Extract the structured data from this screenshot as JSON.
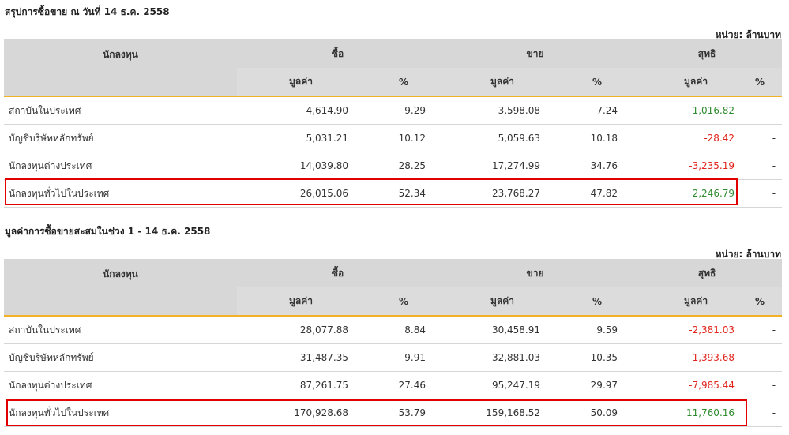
{
  "section1": {
    "title": "สรุปการซื้อขาย ณ วันที่ 14 ธ.ค. 2558",
    "unit": "หน่วย: ล้านบาท",
    "headers": {
      "investor": "นักลงทุน",
      "buy": "ซื้อ",
      "sell": "ขาย",
      "net": "สุทธิ",
      "value": "มูลค่า",
      "percent": "%"
    },
    "rows": [
      {
        "name": "สถาบันในประเทศ",
        "buy_value": "4,614.90",
        "buy_pct": "9.29",
        "sell_value": "3,598.08",
        "sell_pct": "7.24",
        "net_value": "1,016.82",
        "net_pct": "-",
        "net_sign": "pos"
      },
      {
        "name": "บัญชีบริษัทหลักทรัพย์",
        "buy_value": "5,031.21",
        "buy_pct": "10.12",
        "sell_value": "5,059.63",
        "sell_pct": "10.18",
        "net_value": "-28.42",
        "net_pct": "-",
        "net_sign": "neg"
      },
      {
        "name": "นักลงทุนต่างประเทศ",
        "buy_value": "14,039.80",
        "buy_pct": "28.25",
        "sell_value": "17,274.99",
        "sell_pct": "34.76",
        "net_value": "-3,235.19",
        "net_pct": "-",
        "net_sign": "neg"
      },
      {
        "name": "นักลงทุนทั่วไปในประเทศ",
        "buy_value": "26,015.06",
        "buy_pct": "52.34",
        "sell_value": "23,768.27",
        "sell_pct": "47.82",
        "net_value": "2,246.79",
        "net_pct": "-",
        "net_sign": "pos"
      }
    ]
  },
  "section2": {
    "title": "มูลค่าการซื้อขายสะสมในช่วง 1 - 14 ธ.ค. 2558",
    "unit": "หน่วย: ล้านบาท",
    "headers": {
      "investor": "นักลงทุน",
      "buy": "ซื้อ",
      "sell": "ขาย",
      "net": "สุทธิ",
      "value": "มูลค่า",
      "percent": "%"
    },
    "rows": [
      {
        "name": "สถาบันในประเทศ",
        "buy_value": "28,077.88",
        "buy_pct": "8.84",
        "sell_value": "30,458.91",
        "sell_pct": "9.59",
        "net_value": "-2,381.03",
        "net_pct": "-",
        "net_sign": "neg"
      },
      {
        "name": "บัญชีบริษัทหลักทรัพย์",
        "buy_value": "31,487.35",
        "buy_pct": "9.91",
        "sell_value": "32,881.03",
        "sell_pct": "10.35",
        "net_value": "-1,393.68",
        "net_pct": "-",
        "net_sign": "neg"
      },
      {
        "name": "นักลงทุนต่างประเทศ",
        "buy_value": "87,261.75",
        "buy_pct": "27.46",
        "sell_value": "95,247.19",
        "sell_pct": "29.97",
        "net_value": "-7,985.44",
        "net_pct": "-",
        "net_sign": "neg"
      },
      {
        "name": "นักลงทุนทั่วไปในประเทศ",
        "buy_value": "170,928.68",
        "buy_pct": "53.79",
        "sell_value": "159,168.52",
        "sell_pct": "50.09",
        "net_value": "11,760.16",
        "net_pct": "-",
        "net_sign": "pos"
      }
    ]
  },
  "colors": {
    "positive": "#2e8b2e",
    "negative": "#e0231b",
    "header_bg": "#d7d7d7",
    "header_underline": "#f3b127",
    "highlight_box": "#e00000"
  }
}
